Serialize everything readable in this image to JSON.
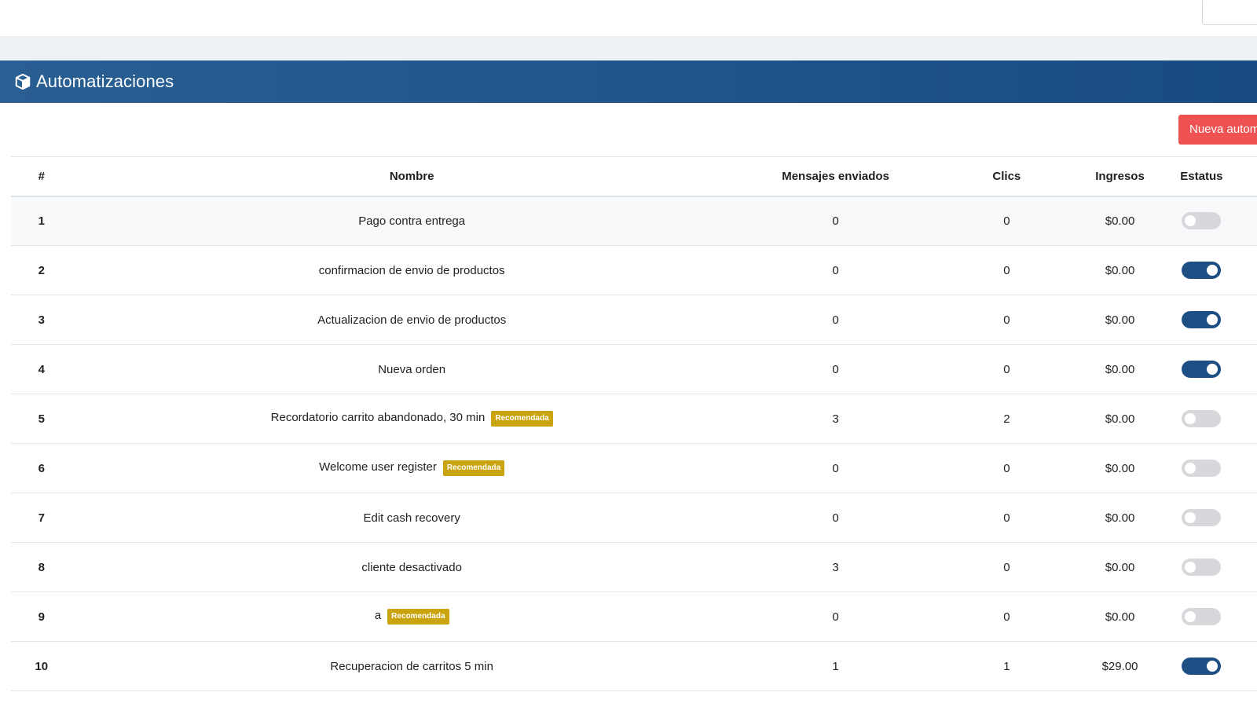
{
  "header": {
    "title": "Automatizaciones",
    "icon": "box-icon"
  },
  "toolbar": {
    "new_label": "Nueva automatización"
  },
  "table": {
    "columns": [
      "#",
      "Nombre",
      "Mensajes enviados",
      "Clics",
      "Ingresos",
      "Estatus"
    ],
    "badge_label": "Recomendada",
    "rows": [
      {
        "num": "1",
        "name": "Pago contra entrega",
        "recommended": false,
        "messages": "0",
        "clicks": "0",
        "revenue": "$0.00",
        "active": false
      },
      {
        "num": "2",
        "name": "confirmacion de envio de productos",
        "recommended": false,
        "messages": "0",
        "clicks": "0",
        "revenue": "$0.00",
        "active": true
      },
      {
        "num": "3",
        "name": "Actualizacion de envio de productos",
        "recommended": false,
        "messages": "0",
        "clicks": "0",
        "revenue": "$0.00",
        "active": true
      },
      {
        "num": "4",
        "name": "Nueva orden",
        "recommended": false,
        "messages": "0",
        "clicks": "0",
        "revenue": "$0.00",
        "active": true
      },
      {
        "num": "5",
        "name": "Recordatorio carrito abandonado, 30 min",
        "recommended": true,
        "messages": "3",
        "clicks": "2",
        "revenue": "$0.00",
        "active": false
      },
      {
        "num": "6",
        "name": "Welcome user register",
        "recommended": true,
        "messages": "0",
        "clicks": "0",
        "revenue": "$0.00",
        "active": false
      },
      {
        "num": "7",
        "name": "Edit cash recovery",
        "recommended": false,
        "messages": "0",
        "clicks": "0",
        "revenue": "$0.00",
        "active": false
      },
      {
        "num": "8",
        "name": "cliente desactivado",
        "recommended": false,
        "messages": "3",
        "clicks": "0",
        "revenue": "$0.00",
        "active": false
      },
      {
        "num": "9",
        "name": "a",
        "recommended": true,
        "messages": "0",
        "clicks": "0",
        "revenue": "$0.00",
        "active": false
      },
      {
        "num": "10",
        "name": "Recuperacion de carritos 5 min",
        "recommended": false,
        "messages": "1",
        "clicks": "1",
        "revenue": "$29.00",
        "active": true
      }
    ]
  },
  "colors": {
    "header_bg": "#1f5589",
    "toggle_on": "#1d4f85",
    "toggle_off": "#d6d8db",
    "badge": "#c9a40e",
    "new_button": "#ee5253"
  }
}
